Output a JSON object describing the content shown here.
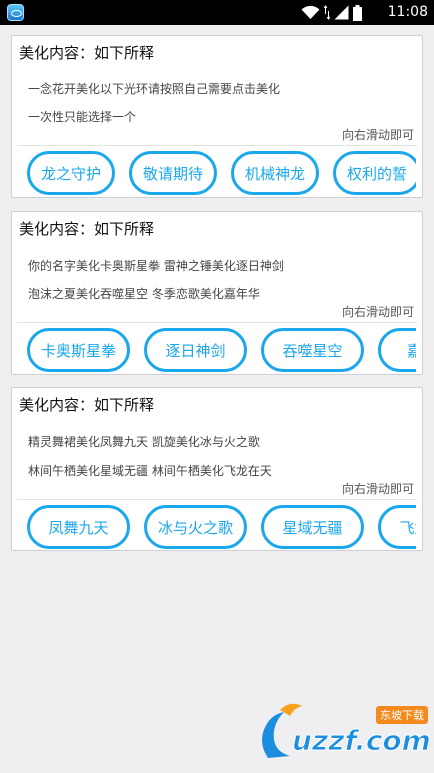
{
  "status_bar": {
    "time": "11:08"
  },
  "cards": [
    {
      "title": "美化内容：如下所释",
      "line1": "一念花开美化以下光环请按照自己需要点击美化",
      "line2": "一次性只能选择一个",
      "hint": "向右滑动即可",
      "chips": [
        "龙之守护",
        "敬请期待",
        "机械神龙",
        "权利的誓"
      ]
    },
    {
      "title": "美化内容：如下所释",
      "line1": "你的名字美化卡奥斯星拳  雷神之锤美化逐日神剑",
      "line2": "泡沫之夏美化吞噬星空  冬季恋歌美化嘉年华",
      "hint": "向右滑动即可",
      "chips": [
        "卡奥斯星拳",
        "逐日神剑",
        "吞噬星空",
        "嘉年华"
      ]
    },
    {
      "title": "美化内容：如下所释",
      "line1": "精灵舞裙美化凤舞九天  凯旋美化冰与火之歌",
      "line2": "林间午栖美化星域无疆  林间午栖美化飞龙在天",
      "hint": "向右滑动即可",
      "chips": [
        "凤舞九天",
        "冰与火之歌",
        "星域无疆",
        "飞龙在天"
      ]
    }
  ],
  "watermark": {
    "brand": "uzzf.com",
    "badge": "东坡下载"
  }
}
